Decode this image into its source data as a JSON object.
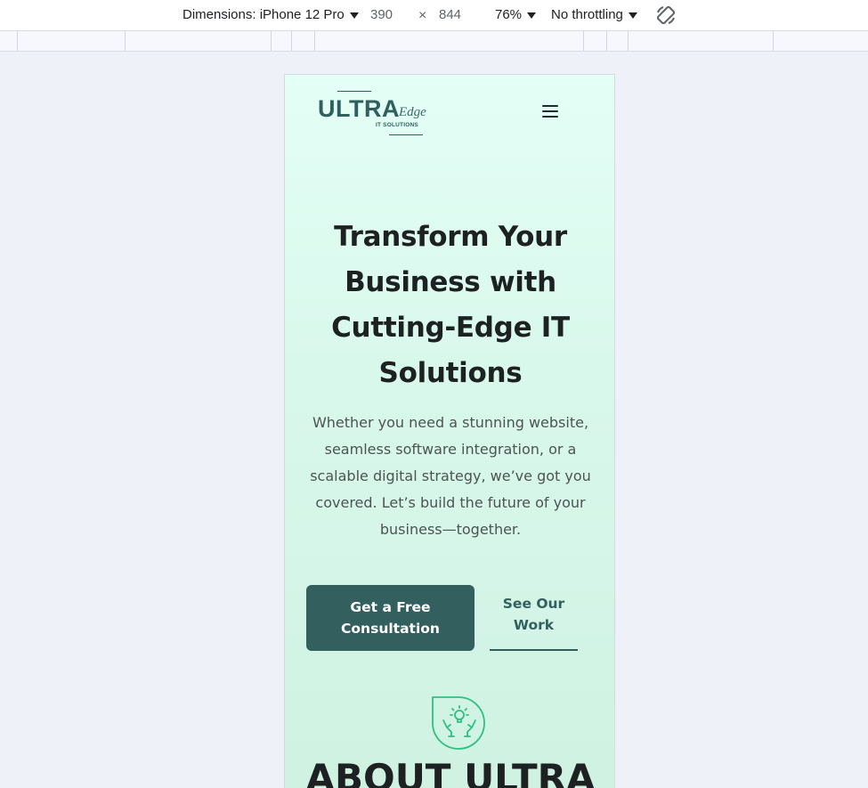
{
  "devtools": {
    "dimensions_label": "Dimensions: iPhone 12 Pro",
    "width": "390",
    "times": "×",
    "height": "844",
    "zoom": "76%",
    "throttling": "No throttling",
    "rotate_icon": "rotate-icon"
  },
  "site": {
    "logo": {
      "ultra": "ULTRA",
      "edge": "Edge",
      "it_solutions": "IT SOLUTIONS"
    },
    "menu_icon": "hamburger-menu-icon",
    "hero": {
      "title": "Transform Your Business with Cutting-Edge IT Solutions",
      "text": "Whether you need a stunning website, seamless software integration, or a scalable digital strategy, we’ve got you covered. Let’s build the future of your business—together."
    },
    "buttons": {
      "primary": "Get a Free Consultation",
      "secondary": "See Our Work"
    },
    "about": {
      "icon": "lightbulb-hands-icon",
      "title": "ABOUT ULTRA"
    }
  },
  "colors": {
    "brand": "#33605f",
    "accent_green": "#2fbf7f",
    "hero_bg": "#e4fff6"
  }
}
